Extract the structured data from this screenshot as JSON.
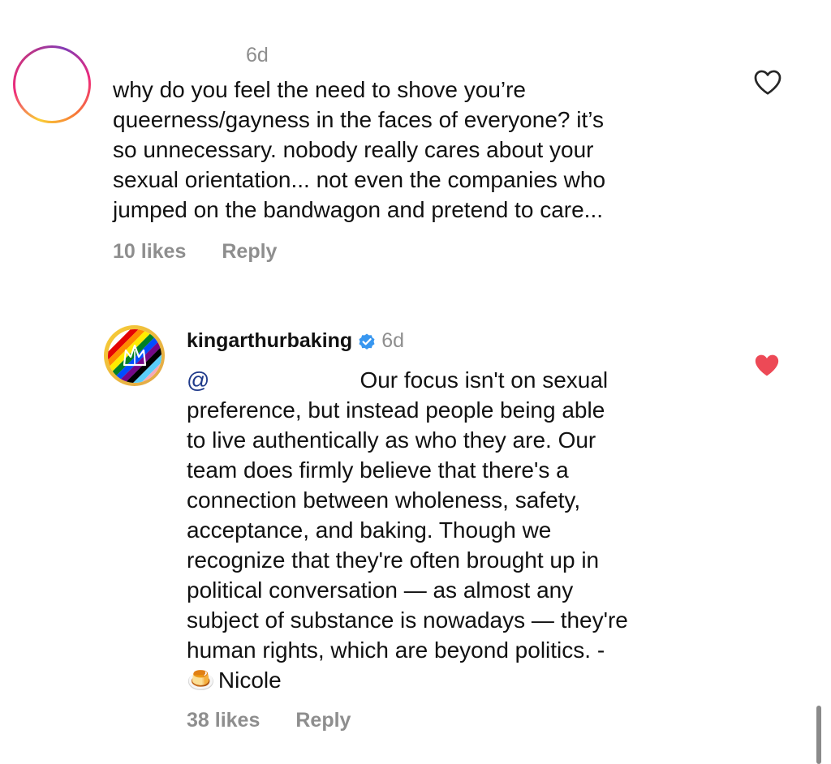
{
  "comment1": {
    "time": "6d",
    "text": "why do you feel the need to shove you’re\nqueerness/gayness in the faces of everyone? it’s\nso unnecessary. nobody really cares about your\nsexual orientation... not even the companies who\njumped on the bandwagon and pretend to care...",
    "likes": "10 likes",
    "reply": "Reply",
    "liked": false
  },
  "comment2": {
    "username": "kingarthurbaking",
    "verified": true,
    "time": "6d",
    "mention": "@",
    "text_first_line": "Our focus isn't on sexual",
    "text_body": "preference, but instead people being able\nto live authentically as who they are. Our\nteam does firmly believe that there's a\nconnection between wholeness, safety,\nacceptance, and baking. Though we\nrecognize that they're often brought up in\npolitical conversation — as almost any\nsubject of substance is nowadays — they're\nhuman rights, which are beyond politics. -",
    "signature_emoji": "🍮",
    "signature": "Nicole",
    "likes": "38 likes",
    "reply": "Reply",
    "liked": true,
    "like_color": "#ed4956"
  },
  "icons": {
    "avatar_ring": "story-ring-avatar",
    "heart_outline": "heart-outline-icon",
    "heart_filled": "heart-filled-icon",
    "verified": "verified-badge-icon"
  },
  "colors": {
    "secondary_text": "#8e8e8e",
    "verified_blue": "#3897f0",
    "like_red": "#ed4956"
  }
}
